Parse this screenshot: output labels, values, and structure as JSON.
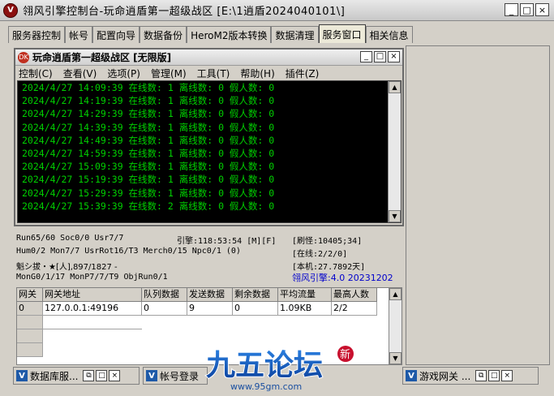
{
  "window": {
    "title": "翎风引擎控制台-玩命逍盾第一超级战区 [E:\\1逍盾2024040101\\]",
    "icon": "V",
    "buttons": [
      "_",
      "□",
      "×"
    ]
  },
  "tabs": [
    {
      "label": "服务器控制",
      "active": false
    },
    {
      "label": "帐号",
      "active": false
    },
    {
      "label": "配置向导",
      "active": false
    },
    {
      "label": "数据备份",
      "active": false
    },
    {
      "label": "HeroM2版本转换",
      "active": false
    },
    {
      "label": "数据清理",
      "active": false
    },
    {
      "label": "服务窗口",
      "active": true
    },
    {
      "label": "相关信息",
      "active": false
    }
  ],
  "inner_window": {
    "title": "玩命逍盾第一超级战区 [无限版]",
    "icon": "DK",
    "menu": [
      "控制(C)",
      "查看(V)",
      "选项(P)",
      "管理(M)",
      "工具(T)",
      "帮助(H)",
      "插件(Z)"
    ],
    "log": [
      "2024/4/27 14:09:39 在线数: 1 离线数: 0 假人数: 0",
      "2024/4/27 14:19:39 在线数: 1 离线数: 0 假人数: 0",
      "2024/4/27 14:29:39 在线数: 1 离线数: 0 假人数: 0",
      "2024/4/27 14:39:39 在线数: 1 离线数: 0 假人数: 0",
      "2024/4/27 14:49:39 在线数: 1 离线数: 0 假人数: 0",
      "2024/4/27 14:59:39 在线数: 1 离线数: 0 假人数: 0",
      "2024/4/27 15:09:39 在线数: 1 离线数: 0 假人数: 0",
      "2024/4/27 15:19:39 在线数: 1 离线数: 0 假人数: 0",
      "2024/4/27 15:29:39 在线数: 1 离线数: 0 假人数: 0",
      "2024/4/27 15:39:39 在线数: 2 离线数: 0 假人数: 0"
    ]
  },
  "status": {
    "run": "Run65/60 Soc0/0 Usr7/7",
    "engine": "引擎:118:53:54 [M][F]",
    "refresh": "[刷怪:10405;34]",
    "hum": "Hum0/2 Mon7/7 UsrRot16/T3 Merch0/15 Npc0/1 (0)",
    "online": "[在线:2/2/0]",
    "player": "魁シ拔・★[人],897/1827 -",
    "local": "[本机:27.7892天]",
    "mon": "MonG0/1/17 MonP7/7/T9 ObjRun0/1",
    "version": "翎风引擎:4.0 20231202"
  },
  "gateway_table": {
    "headers": [
      "网关",
      "网关地址",
      "队列数据",
      "发送数据",
      "剩余数据",
      "平均流量",
      "最高人数"
    ],
    "rows": [
      [
        "0",
        "127.0.0.1:49196",
        "0",
        "9",
        "0",
        "1.09KB",
        "2/2"
      ]
    ]
  },
  "docked": [
    {
      "label": "数据库服...",
      "icon": "V"
    },
    {
      "label": "帐号登录",
      "icon": "V"
    },
    {
      "label": "游戏网关 ...",
      "icon": "V"
    }
  ],
  "watermark": {
    "text": "九五论坛",
    "url": "www.95gm.com",
    "badge": "新"
  }
}
